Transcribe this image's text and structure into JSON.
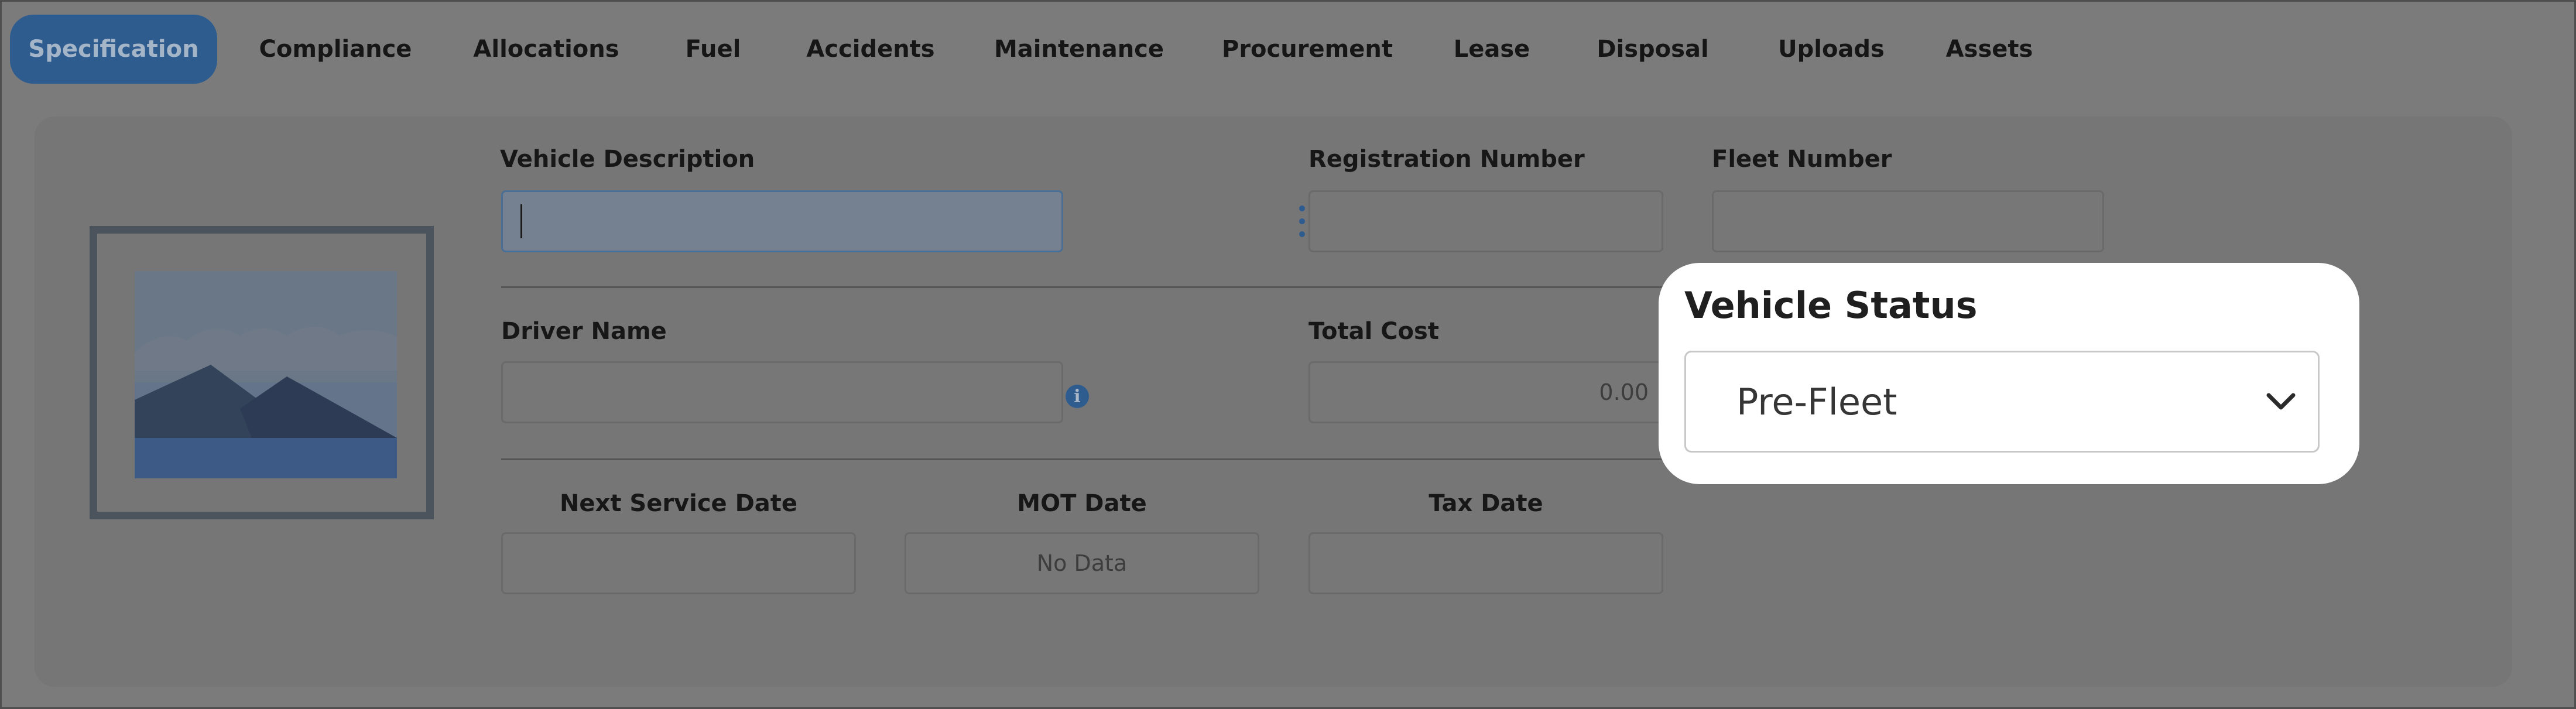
{
  "tabs": [
    {
      "label": "Specification",
      "active": true
    },
    {
      "label": "Compliance"
    },
    {
      "label": "Allocations"
    },
    {
      "label": "Fuel"
    },
    {
      "label": "Accidents"
    },
    {
      "label": "Maintenance"
    },
    {
      "label": "Procurement"
    },
    {
      "label": "Lease"
    },
    {
      "label": "Disposal"
    },
    {
      "label": "Uploads"
    },
    {
      "label": "Assets"
    }
  ],
  "form": {
    "vehicle_description": {
      "label": "Vehicle Description",
      "value": ""
    },
    "registration_number": {
      "label": "Registration Number",
      "value": ""
    },
    "fleet_number": {
      "label": "Fleet Number",
      "value": ""
    },
    "driver_name": {
      "label": "Driver Name",
      "value": ""
    },
    "total_cost": {
      "label": "Total Cost",
      "value": "0.00"
    },
    "next_service_date": {
      "label": "Next Service Date",
      "value": ""
    },
    "mot_date": {
      "label": "MOT Date",
      "value": "No Data"
    },
    "tax_date": {
      "label": "Tax Date",
      "value": ""
    }
  },
  "vehicle_status": {
    "label": "Vehicle Status",
    "selected": "Pre-Fleet"
  },
  "icons": {
    "image_placeholder": "image-placeholder-icon",
    "kebab": "kebab-menu-icon",
    "info": "info-icon",
    "chevron": "chevron-down-icon"
  },
  "colors": {
    "accent": "#2f5c8f",
    "overlay_background": "#7b7b7b",
    "highlight_background": "#ffffff"
  }
}
